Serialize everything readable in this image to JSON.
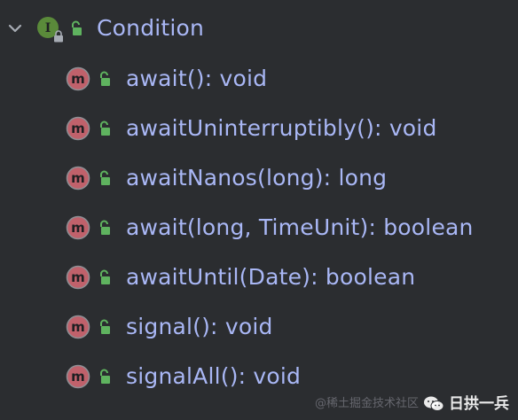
{
  "tree": {
    "interface_node": {
      "label": "Condition",
      "icon": "interface-icon",
      "icon_letter": "I",
      "expanded": true
    },
    "methods": [
      {
        "label": "await(): void",
        "icon": "method-icon",
        "icon_letter": "m"
      },
      {
        "label": "awaitUninterruptibly(): void",
        "icon": "method-icon",
        "icon_letter": "m"
      },
      {
        "label": "awaitNanos(long): long",
        "icon": "method-icon",
        "icon_letter": "m"
      },
      {
        "label": "await(long, TimeUnit): boolean",
        "icon": "method-icon",
        "icon_letter": "m"
      },
      {
        "label": "awaitUntil(Date): boolean",
        "icon": "method-icon",
        "icon_letter": "m"
      },
      {
        "label": "signal(): void",
        "icon": "method-icon",
        "icon_letter": "m"
      },
      {
        "label": "signalAll(): void",
        "icon": "method-icon",
        "icon_letter": "m"
      }
    ]
  },
  "watermark": {
    "faint_text": "@稀土掘金技术社区",
    "brand_text": "日拱一兵",
    "logo_icon": "wechat-icon"
  },
  "colors": {
    "background": "#2b2d30",
    "label_text": "#a9b7f5",
    "interface_icon_fill": "#5a8a3a",
    "method_icon_fill": "#c0616b",
    "lock_green": "#5fb35f"
  }
}
